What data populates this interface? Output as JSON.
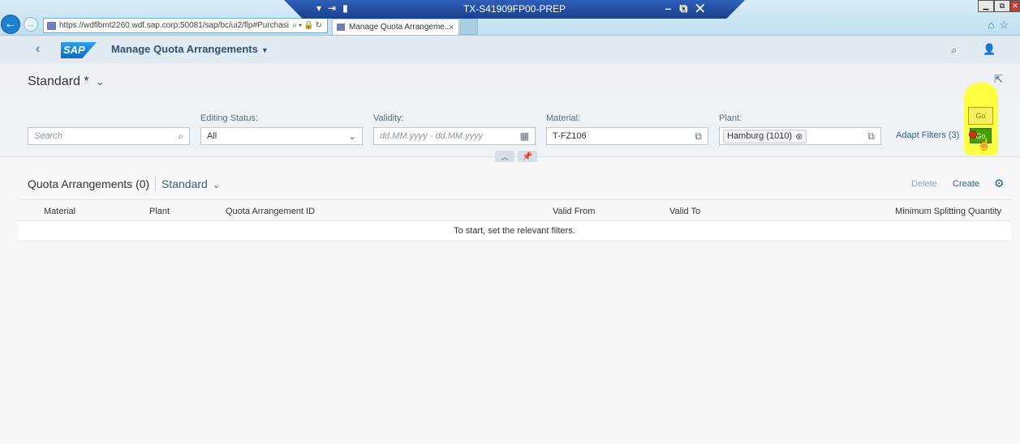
{
  "browser": {
    "url": "https://wdflbmt2260.wdf.sap.corp:50081/sap/bc/ui2/flp#Purchasi",
    "tab_label": "Manage Quota Arrangeme...",
    "remote_title": "TX-S41909FP00-PREP",
    "tab_close": "×"
  },
  "shell": {
    "app_title": "Manage Quota Arrangements"
  },
  "variant": {
    "title": "Standard *"
  },
  "filters": {
    "search_placeholder": "Search",
    "editing_status_label": "Editing Status:",
    "editing_status_value": "All",
    "validity_label": "Validity:",
    "validity_placeholder": "dd.MM.yyyy - dd.MM.yyyy",
    "material_label": "Material:",
    "material_value": "T-FZ106",
    "plant_label": "Plant:",
    "plant_token": "Hamburg (1010)",
    "adapt_filters": "Adapt Filters (3)",
    "go_label": "Go",
    "go_button": "Go"
  },
  "table": {
    "title": "Quota Arrangements (0)",
    "variant": "Standard",
    "delete_label": "Delete",
    "create_label": "Create",
    "columns": [
      "Material",
      "Plant",
      "Quota Arrangement ID",
      "Valid From",
      "Valid To",
      "Minimum Splitting Quantity"
    ],
    "empty_text": "To start, set the relevant filters."
  },
  "icons": {
    "back": "back-arrow-icon",
    "search": "search-icon",
    "user": "user-icon",
    "share": "share-icon",
    "calendar": "calendar-icon",
    "value_help": "value-help-icon",
    "settings": "gear-icon"
  },
  "colors": {
    "brand": "#346187",
    "highlight": "#ffff3a",
    "go_green": "#45a000"
  }
}
